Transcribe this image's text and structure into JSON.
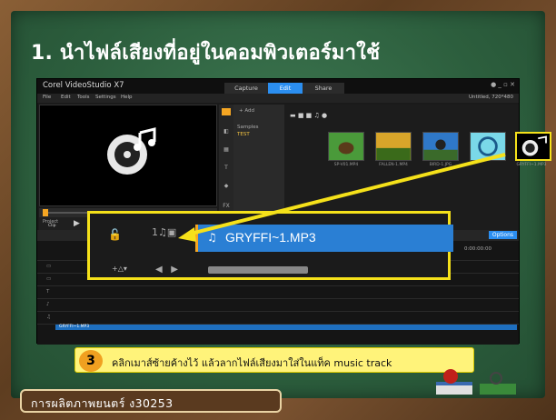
{
  "slide": {
    "title": "1. นำไฟล์เสียงที่อยู่ในคอมพิวเตอร์มาใช้",
    "footer": "การผลิตภาพยนตร์ ง30253"
  },
  "app": {
    "name": "Corel VideoStudio X7",
    "tabs": [
      "Capture",
      "Edit",
      "Share"
    ],
    "active_tab": "Edit",
    "menu": [
      "File",
      "Edit",
      "Tools",
      "Settings",
      "Help"
    ],
    "project_info": "Untitled, 720*480",
    "library": {
      "add_label": "Add",
      "folders": [
        "Samples",
        "TEST"
      ],
      "thumbnails": [
        "SP-V01.MP4",
        "FALLEN-1.MP4",
        "BIRD-1.JPG",
        "",
        "GRYFFI~1.MP3"
      ]
    },
    "player": {
      "project_label": "Project",
      "clip_label": "Clip"
    },
    "timeline": {
      "options_label": "Options",
      "audio_clip_label": "GRYFFI~1.MP3",
      "timecode": "0:00:00:00"
    }
  },
  "zoom": {
    "clip_name": "GRYFFI~1.MP3",
    "track_number": "1"
  },
  "callout": {
    "step": "3",
    "text": "คลิกเมาส์ซ้ายค้างไว้ แล้วลากไฟล์เสียงมาใส่ในแท็ค music track"
  },
  "colors": {
    "board": "#2c5e3d",
    "highlight": "#f5e11a",
    "clip": "#2a7fd4",
    "edit_tab": "#2b8ef0",
    "callout_bg": "#fff37a",
    "step_badge": "#f0a020"
  }
}
